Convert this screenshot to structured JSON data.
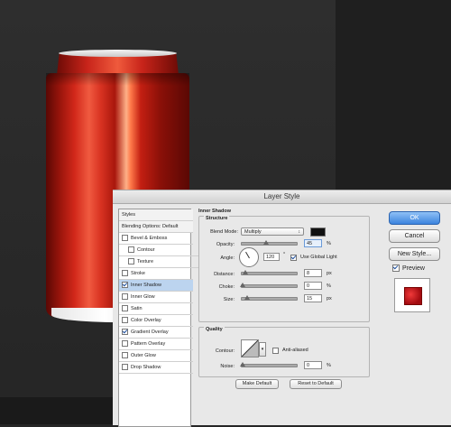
{
  "dialog": {
    "title": "Layer Style"
  },
  "styles_list": {
    "items": [
      {
        "label": "Styles",
        "checkbox": false,
        "checked": false,
        "indent": 0,
        "header": true,
        "selected": false
      },
      {
        "label": "Blending Options: Default",
        "checkbox": false,
        "checked": false,
        "indent": 0,
        "header": true,
        "selected": false
      },
      {
        "label": "Bevel & Emboss",
        "checkbox": true,
        "checked": false,
        "indent": 0,
        "header": false,
        "selected": false
      },
      {
        "label": "Contour",
        "checkbox": true,
        "checked": false,
        "indent": 1,
        "header": false,
        "selected": false
      },
      {
        "label": "Texture",
        "checkbox": true,
        "checked": false,
        "indent": 1,
        "header": false,
        "selected": false
      },
      {
        "label": "Stroke",
        "checkbox": true,
        "checked": false,
        "indent": 0,
        "header": false,
        "selected": false
      },
      {
        "label": "Inner Shadow",
        "checkbox": true,
        "checked": true,
        "indent": 0,
        "header": false,
        "selected": true
      },
      {
        "label": "Inner Glow",
        "checkbox": true,
        "checked": false,
        "indent": 0,
        "header": false,
        "selected": false
      },
      {
        "label": "Satin",
        "checkbox": true,
        "checked": false,
        "indent": 0,
        "header": false,
        "selected": false
      },
      {
        "label": "Color Overlay",
        "checkbox": true,
        "checked": false,
        "indent": 0,
        "header": false,
        "selected": false
      },
      {
        "label": "Gradient Overlay",
        "checkbox": true,
        "checked": true,
        "indent": 0,
        "header": false,
        "selected": false
      },
      {
        "label": "Pattern Overlay",
        "checkbox": true,
        "checked": false,
        "indent": 0,
        "header": false,
        "selected": false
      },
      {
        "label": "Outer Glow",
        "checkbox": true,
        "checked": false,
        "indent": 0,
        "header": false,
        "selected": false
      },
      {
        "label": "Drop Shadow",
        "checkbox": true,
        "checked": false,
        "indent": 0,
        "header": false,
        "selected": false
      }
    ]
  },
  "inner_shadow": {
    "title": "Inner Shadow",
    "structure_title": "Structure",
    "blend_mode_label": "Blend Mode:",
    "blend_mode_value": "Multiply",
    "shadow_color": "#000000",
    "opacity_label": "Opacity:",
    "opacity_value": "45",
    "opacity_unit": "%",
    "angle_label": "Angle:",
    "angle_value": "120",
    "angle_unit": "°",
    "use_global_light_label": "Use Global Light",
    "use_global_light_checked": true,
    "distance_label": "Distance:",
    "distance_value": "8",
    "distance_unit": "px",
    "choke_label": "Choke:",
    "choke_value": "0",
    "choke_unit": "%",
    "size_label": "Size:",
    "size_value": "15",
    "size_unit": "px",
    "quality_title": "Quality",
    "contour_label": "Contour:",
    "anti_aliased_label": "Anti-aliased",
    "anti_aliased_checked": false,
    "noise_label": "Noise:",
    "noise_value": "0",
    "noise_unit": "%",
    "make_default_label": "Make Default",
    "reset_default_label": "Reset to Default"
  },
  "right_buttons": {
    "ok": "OK",
    "cancel": "Cancel",
    "new_style": "New Style...",
    "preview_label": "Preview",
    "preview_checked": true
  }
}
